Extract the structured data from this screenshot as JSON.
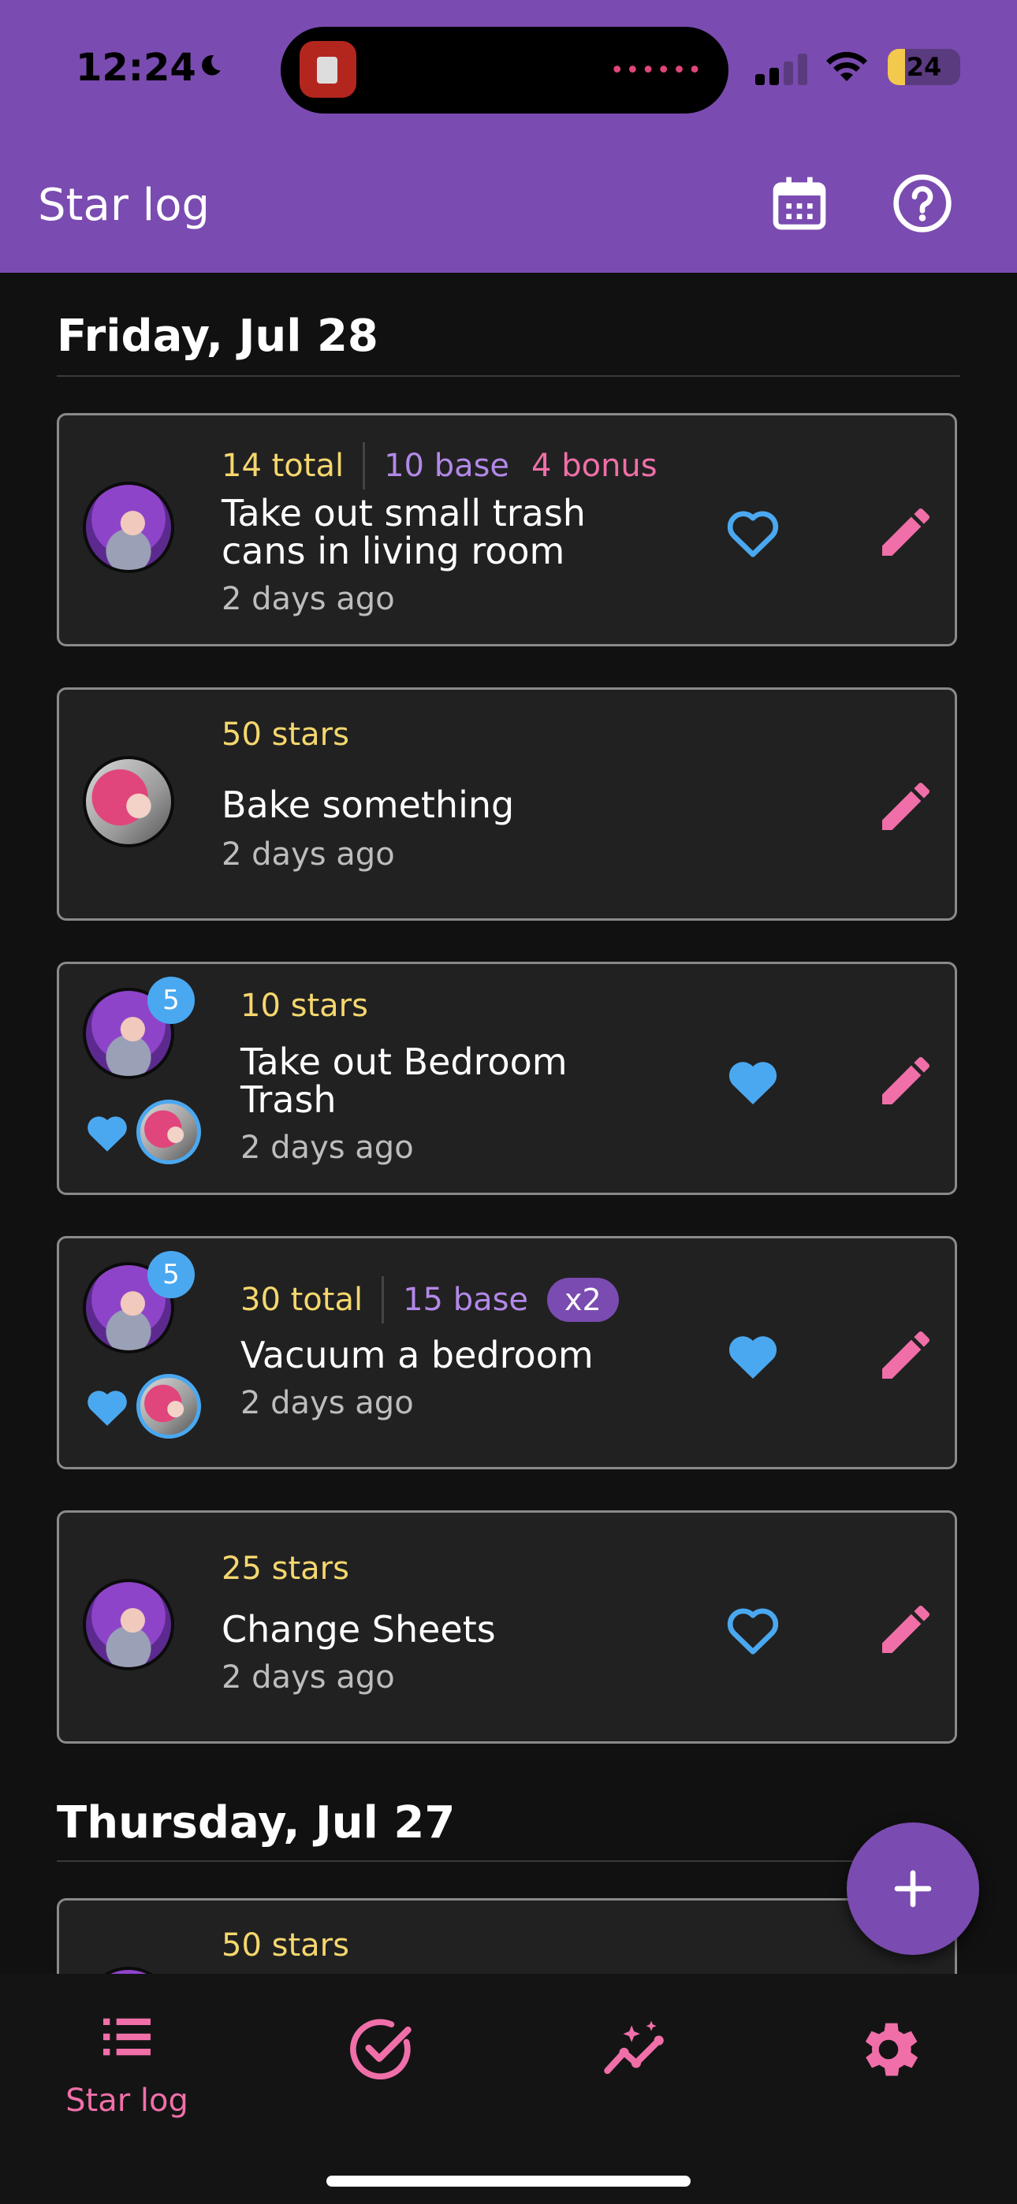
{
  "status_bar": {
    "time": "12:24",
    "battery": "24",
    "battery_fraction": 0.24,
    "activity_icon": "dots-icon"
  },
  "app_bar": {
    "title": "Star log",
    "actions": [
      "calendar-icon",
      "help-icon"
    ]
  },
  "sections": [
    {
      "date": "Friday, Jul 28",
      "entries": [
        {
          "avatar": "purple-hair-user",
          "total": "14 total",
          "base": "10 base",
          "bonus": "4 bonus",
          "title": "Take out small trash cans in living room",
          "time_ago": "2 days ago",
          "liked": false
        },
        {
          "avatar": "pink-hair-user",
          "stars": "50 stars",
          "title": "Bake something",
          "time_ago": "2 days ago"
        },
        {
          "avatar": "purple-hair-user",
          "like_badge": "5",
          "stars": "10 stars",
          "title": "Take out Bedroom Trash",
          "time_ago": "2 days ago",
          "liked": true
        },
        {
          "avatar": "purple-hair-user",
          "like_badge": "5",
          "total": "30 total",
          "base": "15 base",
          "multiplier": "x2",
          "title": "Vacuum a bedroom",
          "time_ago": "2 days ago",
          "liked": true
        },
        {
          "avatar": "purple-hair-user",
          "stars": "25 stars",
          "title": "Change Sheets",
          "time_ago": "2 days ago",
          "liked": false
        }
      ]
    },
    {
      "date": "Thursday, Jul 27",
      "entries": [
        {
          "stars": "50 stars"
        }
      ]
    }
  ],
  "fab": {
    "icon": "plus-icon"
  },
  "bottom_nav": [
    {
      "icon": "list-icon",
      "label": "Star log",
      "active": true
    },
    {
      "icon": "check-circle-icon",
      "label": ""
    },
    {
      "icon": "sparkle-chart-icon",
      "label": ""
    },
    {
      "icon": "gear-icon",
      "label": ""
    }
  ],
  "colors": {
    "primary": "#7a4bb0",
    "accent_pink": "#f06fa8",
    "accent_blue": "#4aa8f0",
    "gold": "#f5d76e",
    "base_purple": "#b388e8",
    "background": "#111111",
    "card": "#212121"
  }
}
